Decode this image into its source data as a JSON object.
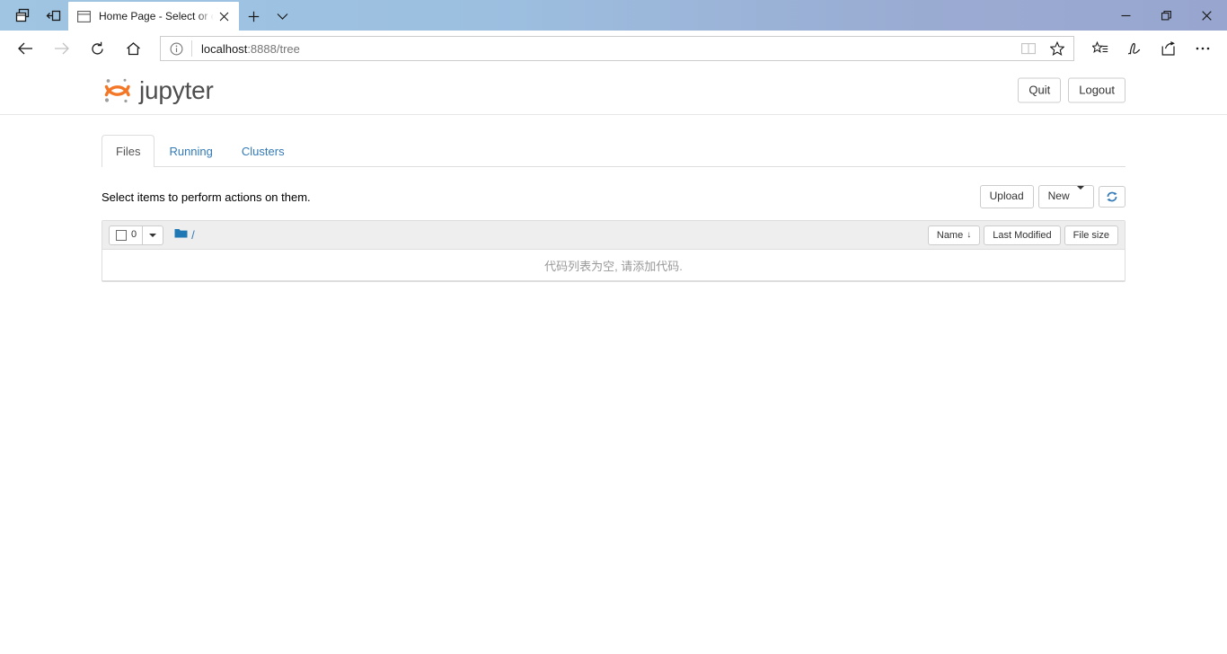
{
  "browser": {
    "left_icons": [
      {
        "name": "tab-overview-icon",
        "label": "Show tab previews"
      },
      {
        "name": "set-tabs-aside-icon",
        "label": "Set these tabs aside"
      }
    ],
    "tab": {
      "favicon": "page-icon",
      "title": "Home Page - Select or c",
      "close_label": "Close tab"
    },
    "new_tab_label": "New tab",
    "tab_menu_label": "Tab actions menu",
    "window_controls": {
      "minimize": "Minimize",
      "restore": "Restore",
      "close": "Close"
    },
    "nav": {
      "back": "Back",
      "forward": "Forward",
      "refresh": "Refresh",
      "home": "Home"
    },
    "address": {
      "info_icon": "info-icon",
      "host": "localhost",
      "path": ":8888/tree",
      "reading_view_icon": "reading-view-icon",
      "favorite_icon": "star-icon"
    },
    "toolbar_icons": [
      {
        "name": "collections-icon",
        "label": "Collections"
      },
      {
        "name": "web-notes-icon",
        "label": "Make a Web Note"
      },
      {
        "name": "share-icon",
        "label": "Share"
      },
      {
        "name": "settings-more-icon",
        "label": "Settings and more"
      }
    ]
  },
  "jupyter": {
    "logo_text": "jupyter",
    "logo_color": "#F37726",
    "header_buttons": [
      {
        "label": "Quit",
        "name": "quit-button"
      },
      {
        "label": "Logout",
        "name": "logout-button"
      }
    ],
    "tabs": [
      {
        "label": "Files",
        "active": true
      },
      {
        "label": "Running",
        "active": false
      },
      {
        "label": "Clusters",
        "active": false
      }
    ],
    "actions": {
      "hint_text": "Select items to perform actions on them.",
      "upload_label": "Upload",
      "new_label": "New",
      "refresh_label": "Refresh file list"
    },
    "list_toolbar": {
      "selected_count": "0",
      "breadcrumb_root": "/",
      "folder_icon": "folder-icon",
      "sort_buttons": [
        {
          "label": "Name",
          "arrow": "↓",
          "name": "sort-name-button"
        },
        {
          "label": "Last Modified",
          "arrow": "",
          "name": "sort-last-modified-button"
        },
        {
          "label": "File size",
          "arrow": "",
          "name": "sort-file-size-button"
        }
      ]
    },
    "empty_message": "代码列表为空, 请添加代码."
  }
}
